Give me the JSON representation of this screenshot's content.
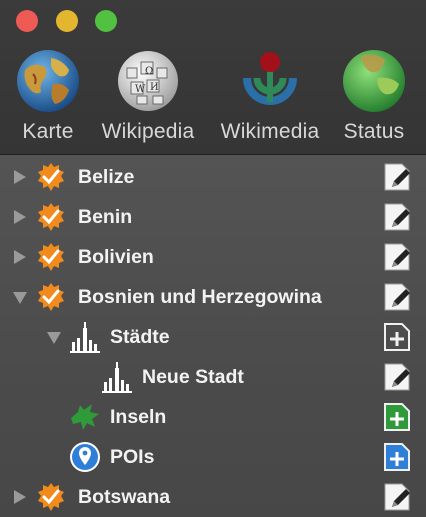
{
  "toolbar": {
    "items": [
      {
        "label": "Karte",
        "icon": "globe-icon"
      },
      {
        "label": "Wikipedia",
        "icon": "wikipedia-globe-icon"
      },
      {
        "label": "Wikimedia",
        "icon": "wikimedia-icon"
      },
      {
        "label": "Status",
        "icon": "status-globe-icon"
      }
    ]
  },
  "tree": {
    "rows": [
      {
        "label": "Belize",
        "icon": "checkmark-badge-icon",
        "disclosure": "collapsed",
        "action": "edit-icon"
      },
      {
        "label": "Benin",
        "icon": "checkmark-badge-icon",
        "disclosure": "collapsed",
        "action": "edit-icon"
      },
      {
        "label": "Bolivien",
        "icon": "checkmark-badge-icon",
        "disclosure": "collapsed",
        "action": "edit-icon"
      },
      {
        "label": "Bosnien und Herzegowina",
        "icon": "checkmark-badge-icon",
        "disclosure": "expanded",
        "action": "edit-icon"
      },
      {
        "label": "Städte",
        "icon": "city-icon",
        "disclosure": "expanded",
        "action": "add-icon"
      },
      {
        "label": "Neue Stadt",
        "icon": "city-icon",
        "disclosure": "none",
        "action": "edit-icon"
      },
      {
        "label": "Inseln",
        "icon": "island-icon",
        "disclosure": "none",
        "action": "add-green-icon"
      },
      {
        "label": "POIs",
        "icon": "map-pin-icon",
        "disclosure": "none",
        "action": "add-blue-icon"
      },
      {
        "label": "Botswana",
        "icon": "checkmark-badge-icon",
        "disclosure": "collapsed",
        "action": "edit-icon"
      }
    ]
  },
  "colors": {
    "close": "#ee5b54",
    "minimize": "#e4b62f",
    "maximize": "#52c040",
    "add_green": "#2e9a3a",
    "add_blue": "#2f7fd8"
  }
}
